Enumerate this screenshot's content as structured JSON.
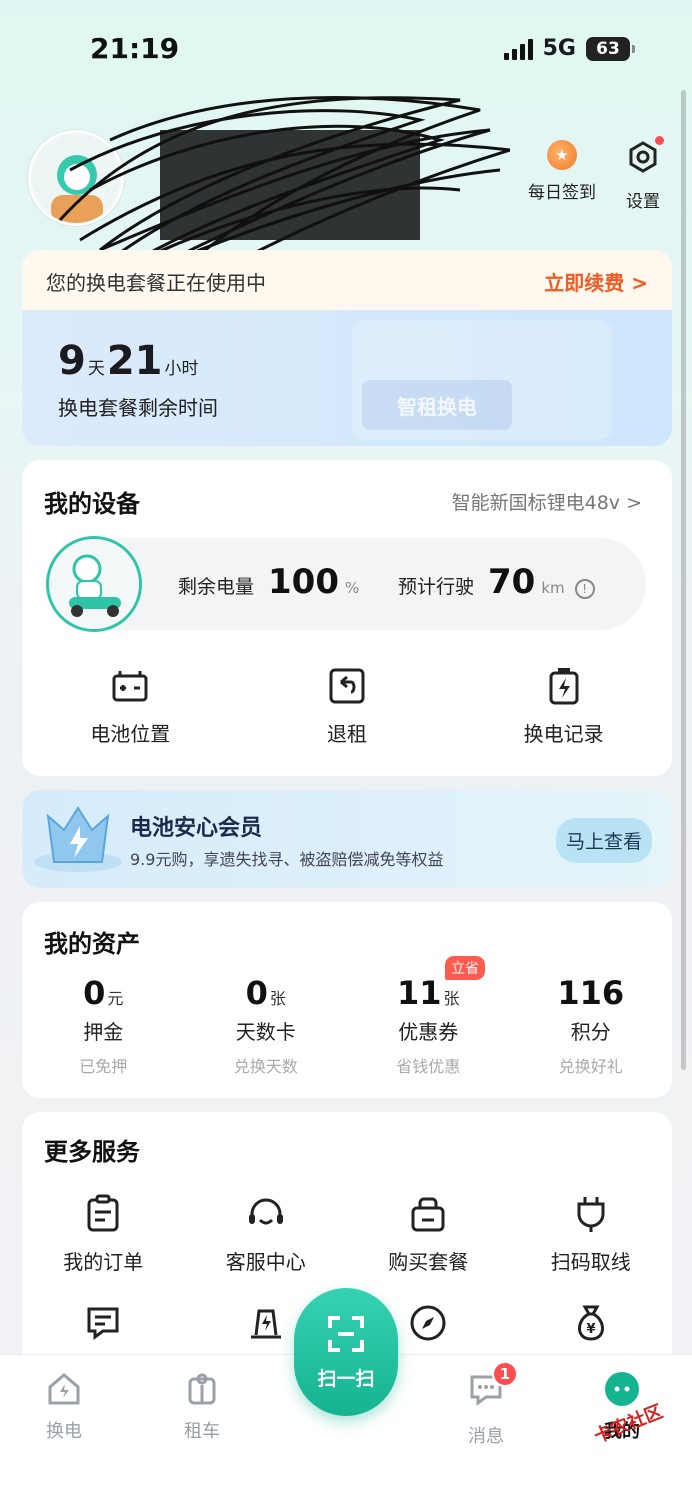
{
  "status_bar": {
    "time": "21:19",
    "network": "5G",
    "battery": "63"
  },
  "header": {
    "checkin_label": "每日签到",
    "settings_label": "设置"
  },
  "package": {
    "notice": "您的换电套餐正在使用中",
    "renew_label": "立即续费 >",
    "days": "9",
    "days_unit": "天",
    "hours": "21",
    "hours_unit": "小时",
    "subtitle": "换电套餐剩余时间",
    "deco_label": "智租换电"
  },
  "devices": {
    "title": "我的设备",
    "battery_model": "智能新国标锂电48v >",
    "remaining_label": "剩余电量",
    "remaining_value": "100",
    "remaining_unit": "%",
    "range_label": "预计行驶",
    "range_value": "70",
    "range_unit": "km",
    "actions": [
      {
        "label": "电池位置",
        "icon": "battery-location-icon"
      },
      {
        "label": "退租",
        "icon": "return-rent-icon"
      },
      {
        "label": "换电记录",
        "icon": "swap-record-icon"
      }
    ]
  },
  "member": {
    "title": "电池安心会员",
    "subtitle": "9.9元购，享遗失找寻、被盗赔偿减免等权益",
    "button": "马上查看"
  },
  "assets": {
    "title": "我的资产",
    "items": [
      {
        "value": "0",
        "unit": "元",
        "label": "押金",
        "sub": "已免押"
      },
      {
        "value": "0",
        "unit": "张",
        "label": "天数卡",
        "sub": "兑换天数"
      },
      {
        "value": "11",
        "unit": "张",
        "label": "优惠券",
        "sub": "省钱优惠",
        "tag": "立省"
      },
      {
        "value": "116",
        "unit": "",
        "label": "积分",
        "sub": "兑换好礼"
      }
    ]
  },
  "services": {
    "title": "更多服务",
    "items": [
      {
        "label": "我的订单",
        "icon": "order-icon"
      },
      {
        "label": "客服中心",
        "icon": "headset-icon"
      },
      {
        "label": "购买套餐",
        "icon": "package-icon"
      },
      {
        "label": "扫码取线",
        "icon": "cable-icon"
      },
      {
        "label": "",
        "icon": "feedback-icon"
      },
      {
        "label": "",
        "icon": "charger-icon"
      },
      {
        "label": "",
        "icon": "compass-icon"
      },
      {
        "label": "",
        "icon": "money-bag-icon"
      }
    ]
  },
  "tabbar": {
    "swap": "换电",
    "rent": "租车",
    "scan": "扫一扫",
    "messages": "消息",
    "messages_badge": "1",
    "mine": "我的"
  },
  "watermark": "卡农社区",
  "colors": {
    "accent": "#16b392",
    "orange": "#f25a24",
    "badge": "#ff4d4f"
  }
}
